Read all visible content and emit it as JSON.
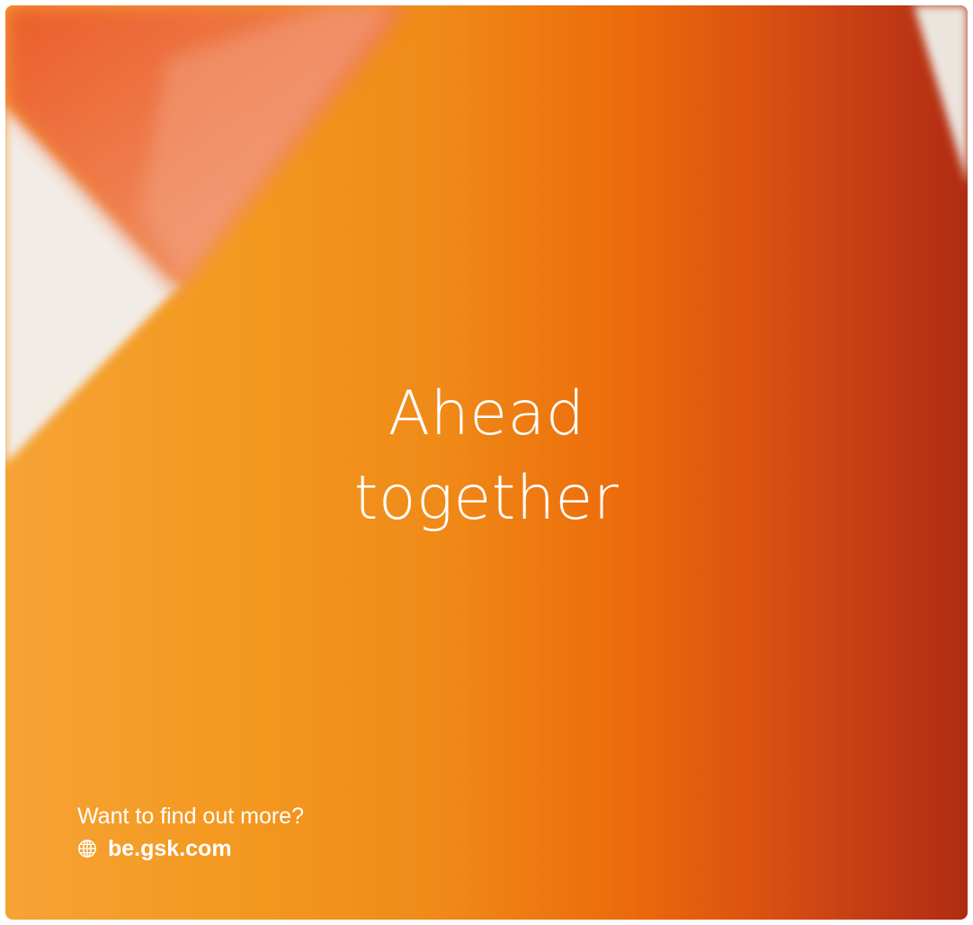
{
  "headline": {
    "line1": "Ahead",
    "line2": "together"
  },
  "footer": {
    "question": "Want to find out more?",
    "link_text": "be.gsk.com",
    "link_icon": "globe-icon"
  },
  "colors": {
    "orange_light": "#f6a335",
    "orange_mid": "#ec6a0a",
    "orange_dark": "#b02c12",
    "background_light": "#f2ece6",
    "text": "#ffffff"
  }
}
